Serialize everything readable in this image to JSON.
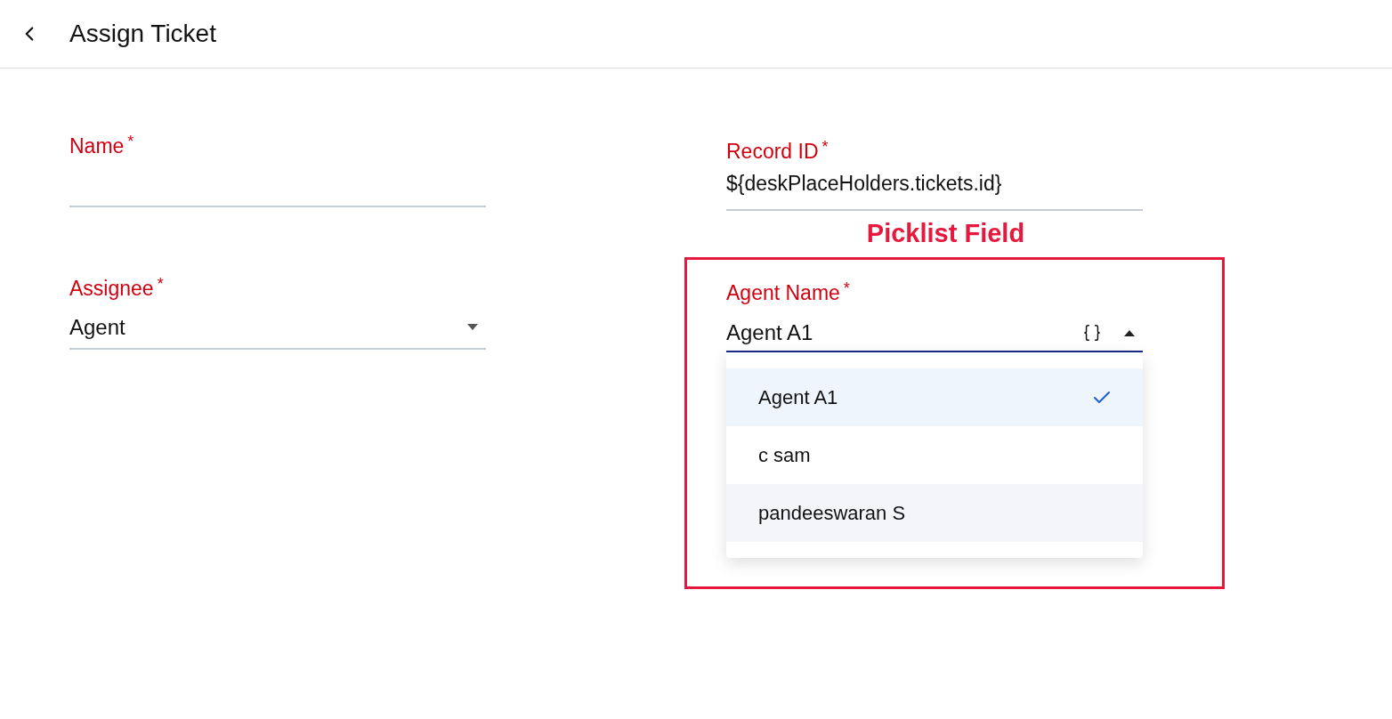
{
  "header": {
    "title": "Assign Ticket"
  },
  "required_marker": "*",
  "left_fields": [
    {
      "kind": "text",
      "label": "Name",
      "required": true
    },
    {
      "kind": "select",
      "label": "Assignee",
      "required": true,
      "value": "Agent"
    }
  ],
  "record_field": {
    "label": "Record ID",
    "required": true,
    "value": "${deskPlaceHolders.tickets.id}"
  },
  "annotation": {
    "title": "Picklist Field"
  },
  "picklist": {
    "label": "Agent Name",
    "required": true,
    "value": "Agent A1",
    "expanded": true,
    "options": [
      {
        "label": "Agent A1",
        "selected": true,
        "highlighted": false
      },
      {
        "label": "c sam",
        "selected": false,
        "highlighted": false
      },
      {
        "label": "pandeeswaran S",
        "selected": false,
        "highlighted": true
      }
    ]
  }
}
